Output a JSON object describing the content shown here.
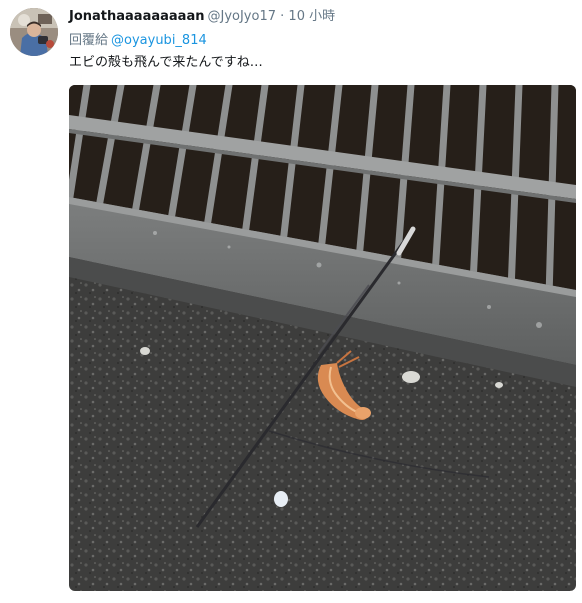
{
  "tweet": {
    "display_name": "Jonathaaaaaaaaan",
    "handle": "@JyoJyo17",
    "separator": "·",
    "time": "10 小時",
    "reply_prefix": "回覆給",
    "reply_to": "@oyayubi_814",
    "text": "エビの殻も飛んで来たんですね…"
  },
  "icons": {
    "avatar": "user-avatar-photo",
    "media": "photo-grate-feather-shrimp"
  }
}
